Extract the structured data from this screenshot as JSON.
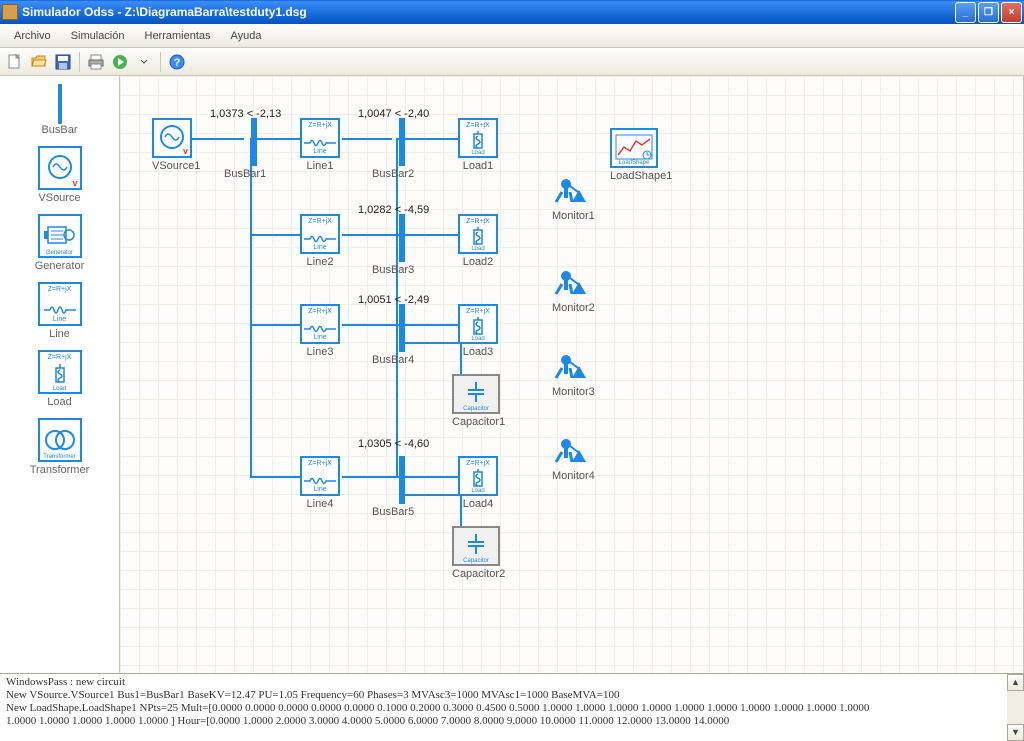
{
  "window": {
    "title": "Simulador Odss - Z:\\DiagramaBarra\\testduty1.dsg"
  },
  "menu": {
    "archivo": "Archivo",
    "simulacion": "Simulación",
    "herramientas": "Herramientas",
    "ayuda": "Ayuda"
  },
  "palette": {
    "busbar": "BusBar",
    "vsource": "VSource",
    "generator": "Generator",
    "line": "Line",
    "load": "Load",
    "transformer": "Transformer"
  },
  "blocks": {
    "vsource1": "VSource1",
    "busbar1": "BusBar1",
    "line1": "Line1",
    "busbar2": "BusBar2",
    "load1": "Load1",
    "loadshape1": "LoadShape1",
    "line2": "Line2",
    "busbar3": "BusBar3",
    "load2": "Load2",
    "monitor1": "Monitor1",
    "line3": "Line3",
    "busbar4": "BusBar4",
    "load3": "Load3",
    "monitor2": "Monitor2",
    "capacitor1": "Capacitor1",
    "monitor3": "Monitor3",
    "line4": "Line4",
    "busbar5": "BusBar5",
    "load4": "Load4",
    "monitor4": "Monitor4",
    "capacitor2": "Capacitor2"
  },
  "annotations": {
    "bus1": "1,0373 < -2,13",
    "bus2": "1,0047 < -2,40",
    "bus3": "1,0282 < -4,59",
    "bus4": "1,0051 < -2,49",
    "bus5": "1,0305 < -4,60"
  },
  "icon_text": {
    "zrix": "Z=R+jX",
    "line": "Line",
    "load": "Load",
    "generator": "Generator",
    "capacitor": "Capacitor",
    "transformer": "Transformer",
    "loadshape": "LoadShape",
    "v": "v"
  },
  "console": {
    "l1": "WindowsPass : new circuit",
    "l2": "New VSource.VSource1 Bus1=BusBar1 BaseKV=12.47 PU=1.05 Frequency=60 Phases=3 MVAsc3=1000 MVAsc1=1000 BaseMVA=100",
    "l3": "New LoadShape.LoadShape1 NPts=25 Mult=[0.0000 0.0000 0.0000 0.0000 0.0000 0.1000 0.2000 0.3000 0.4500 0.5000 1.0000 1.0000 1.0000 1.0000 1.0000 1.0000 1.0000 1.0000 1.0000 1.0000",
    "l4": "1.0000 1.0000 1.0000 1.0000 1.0000 ] Hour=[0.0000 1.0000 2.0000 3.0000 4.0000 5.0000 6.0000 7.0000 8.0000 9.0000 10.0000 11.0000 12.0000 13.0000 14.0000"
  }
}
